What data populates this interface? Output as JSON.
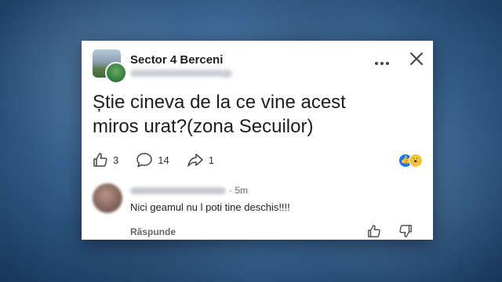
{
  "post": {
    "group_name": "Sector 4 Berceni",
    "text_line1": "Știe cineva de la ce vine acest",
    "text_line2": "miros urat?(zona Secuilor)",
    "like_count": "3",
    "comment_count": "14",
    "share_count": "1",
    "icons": {
      "more": "more-horizontal-icon",
      "close": "close-icon",
      "like": "thumbs-up-icon",
      "comment": "comment-bubble-icon",
      "share": "share-arrow-icon",
      "reactions": [
        "like-reaction-icon",
        "wow-reaction-icon"
      ]
    }
  },
  "comment": {
    "time": "· 5m",
    "text": "Nici geamul nu l poti tine deschis!!!!",
    "reply_label": "Răspunde"
  },
  "colors": {
    "background": "#3f6a97",
    "card": "#ffffff",
    "text": "#1c1e21",
    "secondary_text": "#65676b",
    "like_blue": "#1877f2"
  }
}
